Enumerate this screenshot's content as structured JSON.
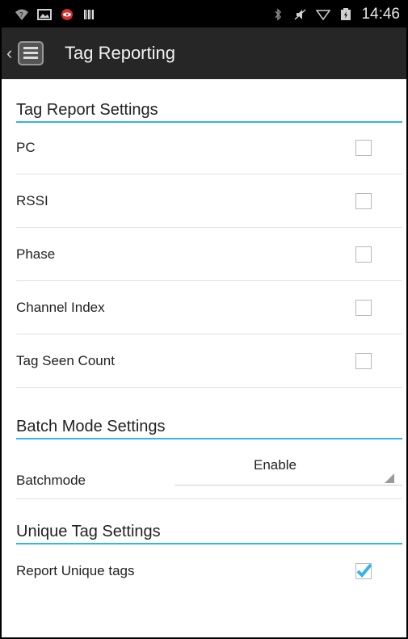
{
  "status_bar": {
    "time": "14:46",
    "left_icons": [
      "wifi-question-icon",
      "image-icon",
      "alert-icon",
      "barcode-icon"
    ],
    "right_icons": [
      "bluetooth-icon",
      "mute-icon",
      "signal-icon",
      "battery-icon"
    ]
  },
  "action_bar": {
    "title": "Tag Reporting",
    "icon": "list-icon"
  },
  "tag_report": {
    "header": "Tag Report Settings",
    "items": [
      {
        "label": "PC",
        "checked": false
      },
      {
        "label": "RSSI",
        "checked": false
      },
      {
        "label": "Phase",
        "checked": false
      },
      {
        "label": "Channel Index",
        "checked": false
      },
      {
        "label": "Tag Seen Count",
        "checked": false
      }
    ]
  },
  "batch_mode": {
    "header": "Batch Mode Settings",
    "label": "Batchmode",
    "value": "Enable"
  },
  "unique_tag": {
    "header": "Unique Tag Settings",
    "label": "Report Unique tags",
    "checked": true
  },
  "colors": {
    "accent": "#33b5e5",
    "action_bar": "#262626",
    "status_bar": "#000000"
  }
}
